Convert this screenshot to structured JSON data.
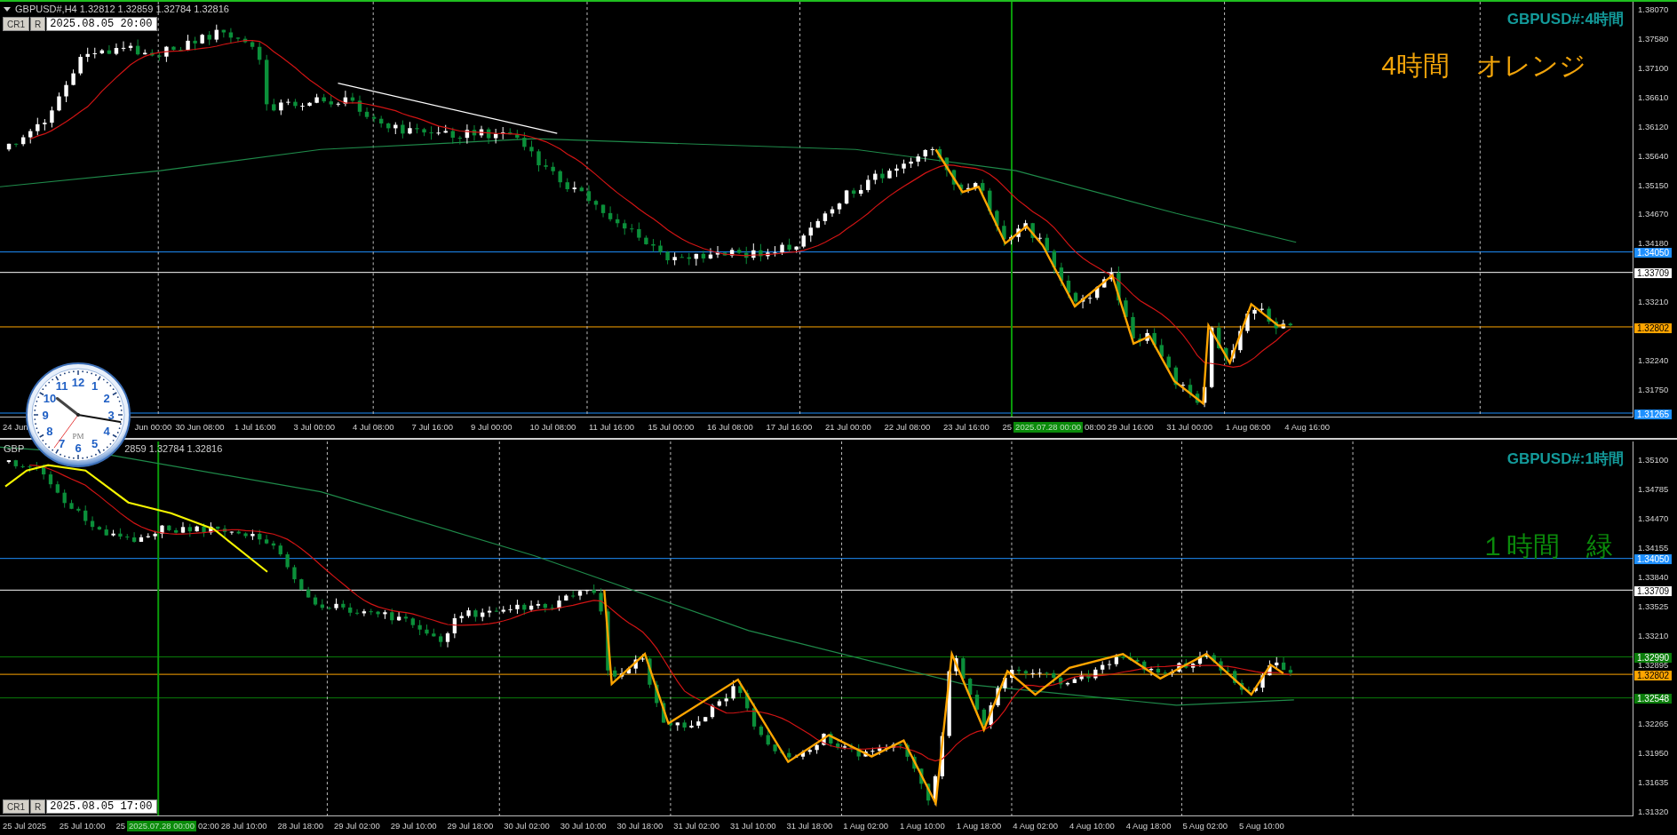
{
  "charts": [
    {
      "kind": "h4",
      "header_parts": [
        "GBPUSD#,H4 1.32812 1.32859 1.32784 1.32816"
      ],
      "buttons": [
        "CR1",
        "R"
      ],
      "date_value": "2025.08.05 20:00",
      "title": "GBPUSD#:4時間",
      "note": {
        "text": "4時間　オレンジ",
        "color": "#f0a30a"
      },
      "price_ticks": [
        "1.38070",
        "1.37580",
        "1.37100",
        "1.36610",
        "1.36120",
        "1.35640",
        "1.35150",
        "1.34670",
        "1.34180",
        "1.33210",
        "1.32240",
        "1.31750"
      ],
      "levels": [
        {
          "price": "1.34050",
          "color": "#1e90ff"
        },
        {
          "price": "1.33709",
          "color": "#ffffff"
        },
        {
          "price": "1.32802",
          "color": "#ffa500"
        },
        {
          "price": "1.31265",
          "color": "#1e90ff"
        }
      ],
      "time_labels": [
        {
          "text": "24 Jun",
          "kind": "label"
        },
        {
          "text": "Jun 00:00",
          "kind": "label"
        },
        {
          "text": "30 Jun 08:00",
          "kind": "label"
        },
        {
          "text": "1 Jul 16:00",
          "kind": "label"
        },
        {
          "text": "3 Jul 00:00",
          "kind": "label"
        },
        {
          "text": "4 Jul 08:00",
          "kind": "label"
        },
        {
          "text": "7 Jul 16:00",
          "kind": "label"
        },
        {
          "text": "9 Jul 00:00",
          "kind": "label"
        },
        {
          "text": "10 Jul 08:00",
          "kind": "label"
        },
        {
          "text": "11 Jul 16:00",
          "kind": "label"
        },
        {
          "text": "15 Jul 00:00",
          "kind": "label"
        },
        {
          "text": "16 Jul 08:00",
          "kind": "label"
        },
        {
          "text": "17 Jul 16:00",
          "kind": "label"
        },
        {
          "text": "21 Jul 00:00",
          "kind": "label"
        },
        {
          "text": "22 Jul 08:00",
          "kind": "label"
        },
        {
          "text": "23 Jul 16:00",
          "kind": "label"
        },
        {
          "text": "25",
          "kind": "fragment"
        },
        {
          "text": "2025.07.28 00:00",
          "kind": "marker"
        },
        {
          "text": "08:00",
          "kind": "fragment"
        },
        {
          "text": "29 Jul 16:00",
          "kind": "label"
        },
        {
          "text": "31 Jul 00:00",
          "kind": "label"
        },
        {
          "text": "1 Aug 08:00",
          "kind": "label"
        },
        {
          "text": "4 Aug 16:00",
          "kind": "label"
        }
      ]
    },
    {
      "kind": "h1",
      "header_parts": [
        "GBP",
        "2859 1.32784 1.32816"
      ],
      "buttons": [
        "CR1",
        "R"
      ],
      "date_value": "2025.08.05 17:00",
      "title": "GBPUSD#:1時間",
      "note": {
        "text": "１時間　緑",
        "color": "#0b8a0b"
      },
      "price_ticks": [
        "1.35100",
        "1.34785",
        "1.34470",
        "1.34155",
        "1.33840",
        "1.33525",
        "1.33210",
        "1.32895",
        "1.32265",
        "1.31950",
        "1.31635",
        "1.31320"
      ],
      "levels": [
        {
          "price": "1.34050",
          "color": "#1e90ff"
        },
        {
          "price": "1.33709",
          "color": "#ffffff"
        },
        {
          "price": "1.32990",
          "color": "#0a7d0a"
        },
        {
          "price": "1.32802",
          "color": "#ffa500"
        },
        {
          "price": "1.32548",
          "color": "#0a7d0a"
        }
      ],
      "time_labels": [
        {
          "text": "25 Jul 2025",
          "kind": "label"
        },
        {
          "text": "25 Jul 10:00",
          "kind": "label"
        },
        {
          "text": "25",
          "kind": "fragment"
        },
        {
          "text": "2025.07.28 00:00",
          "kind": "marker"
        },
        {
          "text": "02:00",
          "kind": "fragment"
        },
        {
          "text": "28 Jul 10:00",
          "kind": "label"
        },
        {
          "text": "28 Jul 18:00",
          "kind": "label"
        },
        {
          "text": "29 Jul 02:00",
          "kind": "label"
        },
        {
          "text": "29 Jul 10:00",
          "kind": "label"
        },
        {
          "text": "29 Jul 18:00",
          "kind": "label"
        },
        {
          "text": "30 Jul 02:00",
          "kind": "label"
        },
        {
          "text": "30 Jul 10:00",
          "kind": "label"
        },
        {
          "text": "30 Jul 18:00",
          "kind": "label"
        },
        {
          "text": "31 Jul 02:00",
          "kind": "label"
        },
        {
          "text": "31 Jul 10:00",
          "kind": "label"
        },
        {
          "text": "31 Jul 18:00",
          "kind": "label"
        },
        {
          "text": "1 Aug 02:00",
          "kind": "label"
        },
        {
          "text": "1 Aug 10:00",
          "kind": "label"
        },
        {
          "text": "1 Aug 18:00",
          "kind": "label"
        },
        {
          "text": "4 Aug 02:00",
          "kind": "label"
        },
        {
          "text": "4 Aug 10:00",
          "kind": "label"
        },
        {
          "text": "4 Aug 18:00",
          "kind": "label"
        },
        {
          "text": "5 Aug 02:00",
          "kind": "label"
        },
        {
          "text": "5 Aug 10:00",
          "kind": "label"
        }
      ]
    }
  ],
  "clock": {
    "numbers": [
      "12",
      "11",
      "1",
      "10",
      "2",
      "9",
      "3",
      "8",
      "4",
      "7",
      "5",
      "6"
    ],
    "label": "PM"
  }
}
